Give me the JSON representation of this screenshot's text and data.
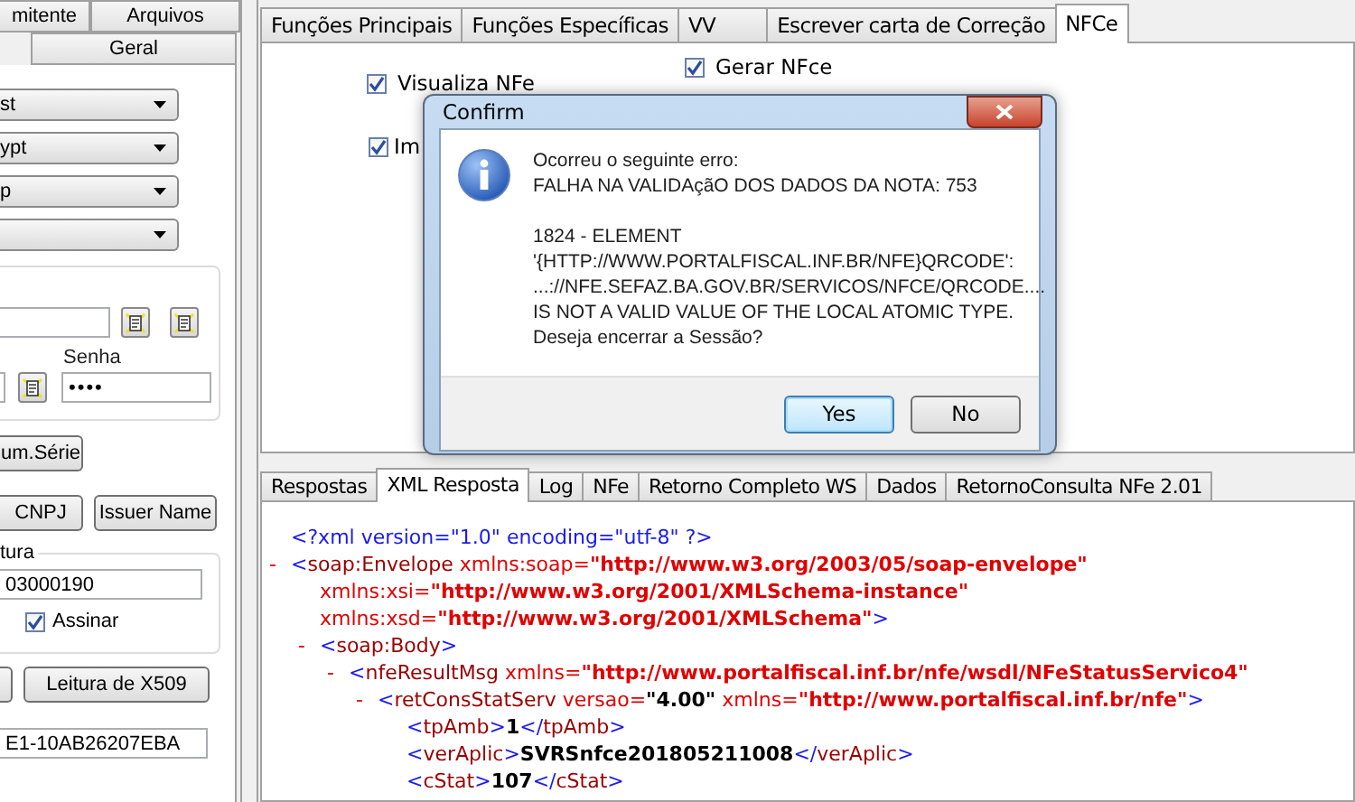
{
  "left_panel": {
    "tabs_row1": [
      {
        "label": "mitente",
        "selected": false
      },
      {
        "label": "Arquivos",
        "selected": false
      }
    ],
    "tabs_row2": [
      {
        "label": "Geral",
        "selected": false
      }
    ],
    "dropdowns": [
      {
        "value": "st"
      },
      {
        "value": "ypt"
      },
      {
        "value": "p"
      }
    ],
    "blank_dropdown": true,
    "cert_group": {
      "password_label": "Senha",
      "password_value": "••••"
    },
    "buttons_row1": [
      "um.Série"
    ],
    "buttons_row2": [
      "CNPJ",
      "Issuer Name"
    ],
    "sign_group": {
      "title": "tura",
      "field_value": "03000190",
      "checkbox": {
        "label": "Assinar",
        "checked": true
      }
    },
    "buttons_row3": [
      "Leitura de X509"
    ],
    "bottom_field": "E1-10AB26207EBA"
  },
  "top_tabs": [
    {
      "label": "Funções Principais",
      "selected": false
    },
    {
      "label": "Funções Específicas",
      "selected": false
    },
    {
      "label": "VV",
      "selected": false
    },
    {
      "label": "Escrever carta de Correção",
      "selected": false
    },
    {
      "label": "NFCe",
      "selected": true
    }
  ],
  "nfce_options": [
    {
      "label": "Visualiza NFe",
      "checked": true
    },
    {
      "label": "Gerar NFce",
      "checked": true
    },
    {
      "label": "Im",
      "checked": true
    }
  ],
  "bottom_tabs": [
    {
      "label": "Respostas",
      "selected": false
    },
    {
      "label": "XML Resposta",
      "selected": true
    },
    {
      "label": "Log",
      "selected": false
    },
    {
      "label": "NFe",
      "selected": false
    },
    {
      "label": "Retorno Completo WS",
      "selected": false
    },
    {
      "label": "Dados",
      "selected": false
    },
    {
      "label": "RetornoConsulta NFe 2.01",
      "selected": false
    }
  ],
  "xml": [
    {
      "parts": [
        {
          "kind": "mark",
          "text": "<?xml version=\"1.0\" encoding=\"utf-8\" ?>"
        }
      ]
    },
    {
      "toggle": "-",
      "parts": [
        {
          "kind": "mark",
          "text": "<"
        },
        {
          "kind": "name",
          "text": "soap:Envelope"
        },
        {
          "kind": "attr",
          "text": " xmlns:soap="
        },
        {
          "kind": "value",
          "text": "\"http://www.w3.org/2003/05/soap-envelope\""
        }
      ],
      "continuation": [
        [
          {
            "kind": "attr",
            "text": "xmlns:xsi="
          },
          {
            "kind": "value",
            "text": "\"http://www.w3.org/2001/XMLSchema-instance\""
          }
        ],
        [
          {
            "kind": "attr",
            "text": "xmlns:xsd="
          },
          {
            "kind": "value",
            "text": "\"http://www.w3.org/2001/XMLSchema\""
          },
          {
            "kind": "mark",
            "text": ">"
          }
        ]
      ],
      "children": [
        {
          "toggle": "-",
          "parts": [
            {
              "kind": "mark",
              "text": "<"
            },
            {
              "kind": "name",
              "text": "soap:Body"
            },
            {
              "kind": "mark",
              "text": ">"
            }
          ],
          "children": [
            {
              "toggle": "-",
              "parts": [
                {
                  "kind": "mark",
                  "text": "<"
                },
                {
                  "kind": "name",
                  "text": "nfeResultMsg"
                },
                {
                  "kind": "attr",
                  "text": " xmlns="
                },
                {
                  "kind": "value",
                  "text": "\"http://www.portalfiscal.inf.br/nfe/wsdl/NFeStatusServico4\""
                }
              ],
              "children": [
                {
                  "toggle": "-",
                  "parts": [
                    {
                      "kind": "mark",
                      "text": "<"
                    },
                    {
                      "kind": "name",
                      "text": "retConsStatServ"
                    },
                    {
                      "kind": "attr",
                      "text": " versao="
                    },
                    {
                      "kind": "text",
                      "text": "\"4.00\""
                    },
                    {
                      "kind": "attr",
                      "text": " xmlns="
                    },
                    {
                      "kind": "value",
                      "text": "\"http://www.portalfiscal.inf.br/nfe\""
                    },
                    {
                      "kind": "mark",
                      "text": ">"
                    }
                  ],
                  "children": [
                    {
                      "parts": [
                        {
                          "kind": "mark",
                          "text": "<"
                        },
                        {
                          "kind": "name",
                          "text": "tpAmb"
                        },
                        {
                          "kind": "mark",
                          "text": ">"
                        },
                        {
                          "kind": "text",
                          "text": "1"
                        },
                        {
                          "kind": "mark",
                          "text": "</"
                        },
                        {
                          "kind": "name",
                          "text": "tpAmb"
                        },
                        {
                          "kind": "mark",
                          "text": ">"
                        }
                      ]
                    },
                    {
                      "parts": [
                        {
                          "kind": "mark",
                          "text": "<"
                        },
                        {
                          "kind": "name",
                          "text": "verAplic"
                        },
                        {
                          "kind": "mark",
                          "text": ">"
                        },
                        {
                          "kind": "text",
                          "text": "SVRSnfce201805211008"
                        },
                        {
                          "kind": "mark",
                          "text": "</"
                        },
                        {
                          "kind": "name",
                          "text": "verAplic"
                        },
                        {
                          "kind": "mark",
                          "text": ">"
                        }
                      ]
                    },
                    {
                      "parts": [
                        {
                          "kind": "mark",
                          "text": "<"
                        },
                        {
                          "kind": "name",
                          "text": "cStat"
                        },
                        {
                          "kind": "mark",
                          "text": ">"
                        },
                        {
                          "kind": "text",
                          "text": "107"
                        },
                        {
                          "kind": "mark",
                          "text": "</"
                        },
                        {
                          "kind": "name",
                          "text": "cStat"
                        },
                        {
                          "kind": "mark",
                          "text": ">"
                        }
                      ]
                    }
                  ]
                }
              ]
            }
          ]
        }
      ]
    }
  ],
  "dialog": {
    "title": "Confirm",
    "message_paragraphs": [
      [
        "Ocorreu o seguinte erro:",
        "FALHA NA VALIDAçãO DOS DADOS DA NOTA: 753"
      ],
      [
        "1824 - ELEMENT",
        "'{HTTP://WWW.PORTALFISCAL.INF.BR/NFE}QRCODE':",
        "...://NFE.SEFAZ.BA.GOV.BR/SERVICOS/NFCE/QRCODE....",
        "IS NOT A VALID VALUE OF THE LOCAL ATOMIC TYPE.",
        "Deseja encerrar a Sessão?"
      ]
    ],
    "buttons": [
      {
        "label": "Yes",
        "selected": true
      },
      {
        "label": "No",
        "selected": false
      }
    ]
  }
}
